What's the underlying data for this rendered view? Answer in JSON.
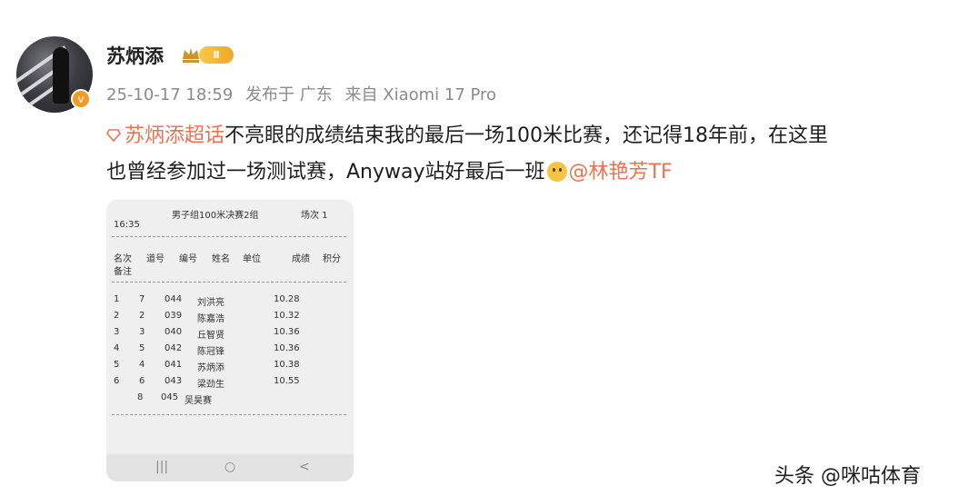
{
  "user": {
    "name": "苏炳添",
    "level_badge": "Ⅱ",
    "verified_icon": "v-verified-icon"
  },
  "meta": {
    "date": "25-10-17 18:59",
    "published_in": "发布于 广东",
    "source": "来自 Xiaomi 17 Pro"
  },
  "post": {
    "topic": "苏炳添超话",
    "text_1": "不亮眼的成绩结束我的最后一场100米比赛，还记得18年前，在这里",
    "text_2": "也曾经参加过一场测试赛，Anyway站好最后一班",
    "mention": "@林艳芳TF"
  },
  "results_sheet": {
    "title": "男子组100米决赛2组",
    "heat": "场次 1",
    "time": "16:35",
    "headers": [
      "名次",
      "道号",
      "编号",
      "姓名",
      "单位",
      "成绩",
      "积分"
    ],
    "header_note": "备注",
    "rows": [
      [
        "1",
        "7",
        "044",
        "刘洪亮",
        "10.28"
      ],
      [
        "2",
        "2",
        "039",
        "陈嘉浩",
        "10.32"
      ],
      [
        "3",
        "3",
        "040",
        "丘智贤",
        "10.36"
      ],
      [
        "4",
        "5",
        "042",
        "陈冠锋",
        "10.36"
      ],
      [
        "5",
        "4",
        "041",
        "苏炳添",
        "10.38"
      ],
      [
        "6",
        "6",
        "043",
        "梁劲生",
        "10.55"
      ],
      [
        "",
        "8",
        "045",
        "吴昊赛",
        ""
      ]
    ],
    "nav": [
      "|||",
      "○",
      "<"
    ]
  },
  "watermark": "头条 @咪咕体育",
  "colors": {
    "link": "#eb7350",
    "meta": "#8a8a8a",
    "badge": "#f3a623"
  }
}
